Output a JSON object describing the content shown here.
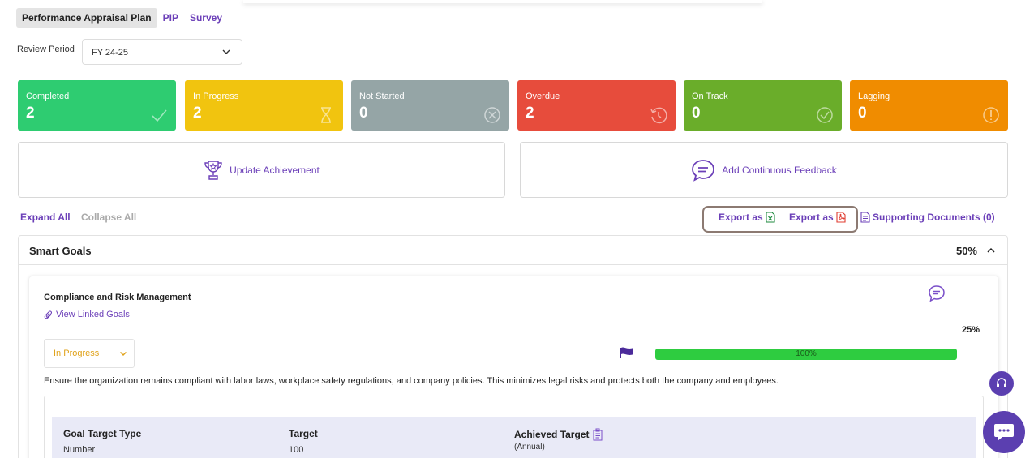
{
  "tabs": [
    {
      "label": "Performance Appraisal Plan",
      "active": true
    },
    {
      "label": "PIP",
      "active": false
    },
    {
      "label": "Survey",
      "active": false
    }
  ],
  "review_period": {
    "label": "Review Period",
    "value": "FY 24-25"
  },
  "status_cards": [
    {
      "label": "Completed",
      "count": "2",
      "color": "#2ecc71",
      "icon": "check-icon"
    },
    {
      "label": "In Progress",
      "count": "2",
      "color": "#f1c40f",
      "icon": "hourglass-icon"
    },
    {
      "label": "Not Started",
      "count": "0",
      "color": "#95a5a6",
      "icon": "cancel-circle-icon"
    },
    {
      "label": "Overdue",
      "count": "2",
      "color": "#e74c3c",
      "icon": "history-icon"
    },
    {
      "label": "On Track",
      "count": "0",
      "color": "#6aad2a",
      "icon": "check-circle-icon"
    },
    {
      "label": "Lagging",
      "count": "0",
      "color": "#f08c00",
      "icon": "alert-circle-icon"
    }
  ],
  "actions": {
    "update_achievement": "Update Achievement",
    "add_feedback": "Add Continuous Feedback"
  },
  "toolbar": {
    "expand_all": "Expand All",
    "collapse_all": "Collapse All",
    "export_excel": "Export as",
    "export_pdf": "Export as",
    "supporting_docs": "Supporting Documents (0)"
  },
  "section": {
    "title": "Smart Goals",
    "percent": "50%"
  },
  "goal": {
    "title": "Compliance and Risk Management",
    "linked_goals": "View Linked Goals",
    "percent": "25%",
    "status": "In Progress",
    "progress_label": "100%",
    "progress_value": 1.0,
    "description": "Ensure the organization remains compliant with labor laws, workplace safety regulations, and company policies. This minimizes legal risks and protects both the company and employees.",
    "table": {
      "col1_header": "Goal Target Type",
      "col1_value": "Number",
      "col2_header": "Target",
      "col2_value": "100",
      "col3_header": "Achieved Target",
      "col3_value": "(Annual)"
    }
  },
  "colors": {
    "accent": "#6b3fb8",
    "progress": "#2ecc40",
    "status_in_progress": "#e0a21a"
  }
}
